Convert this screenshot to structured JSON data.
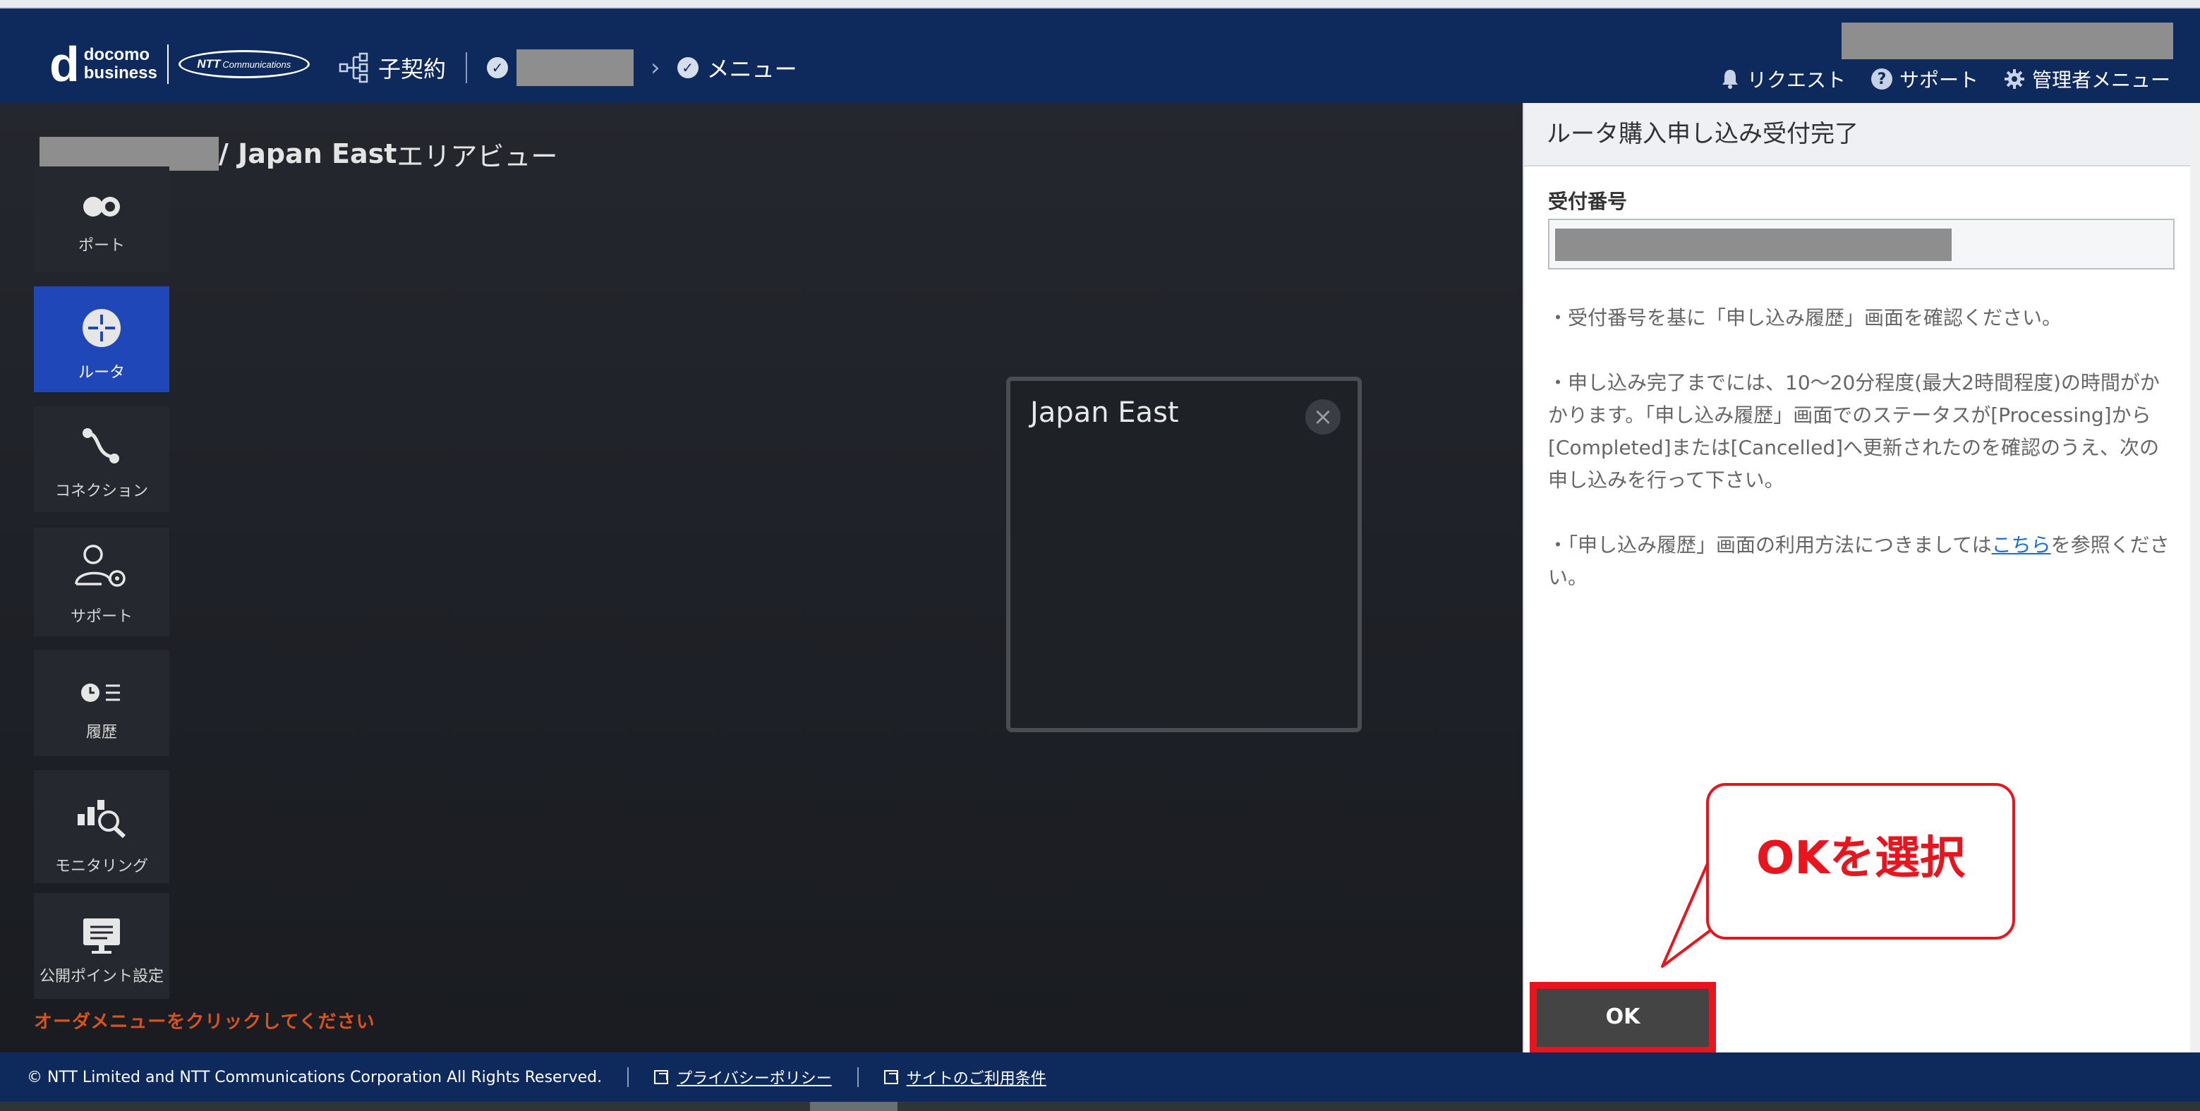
{
  "header": {
    "brand": {
      "glyph": "d",
      "line1": "docomo",
      "line2": "business",
      "ntt_logo": "NTT Communications",
      "ntt_bold": "NTT",
      "ntt_rest": "Communications"
    },
    "nav": {
      "contract_label": "子契約",
      "menu_label": "メニュー"
    },
    "links": {
      "request": "リクエスト",
      "support": "サポート",
      "admin_menu": "管理者メニュー"
    }
  },
  "main": {
    "title_suffix": "/ Japan East",
    "title_view": " エリアビュー",
    "sidebar": [
      {
        "label": "ポート",
        "icon": "port-icon",
        "active": false
      },
      {
        "label": "ルータ",
        "icon": "router-icon",
        "active": true
      },
      {
        "label": "コネクション",
        "icon": "connection-icon",
        "active": false
      },
      {
        "label": "サポート",
        "icon": "support-user-gear-icon",
        "active": false
      },
      {
        "label": "履歴",
        "icon": "history-clock-list-icon",
        "active": false
      },
      {
        "label": "モニタリング",
        "icon": "monitoring-chart-magnifier-icon",
        "active": false
      },
      {
        "label": "公開ポイント設定",
        "icon": "public-point-monitor-icon",
        "active": false
      }
    ],
    "order_hint": "オーダメニューをクリックしてください",
    "region_card": {
      "title": "Japan East",
      "close": "×"
    }
  },
  "panel": {
    "title": "ルータ購入申し込み受付完了",
    "field_label": "受付番号",
    "note1": "・受付番号を基に「申し込み履歴」画面を確認ください。",
    "note2": "・申し込み完了までには、10〜20分程度(最大2時間程度)の時間がかかります。「申し込み履歴」画面でのステータスが[Processing]から[Completed]または[Cancelled]へ更新されたのを確認のうえ、次の申し込みを行って下さい。",
    "note3_prefix": "・「申し込み履歴」画面の利用方法につきましては",
    "note3_link": "こちら",
    "note3_suffix": "を参照ください。",
    "ok_label": "OK"
  },
  "callout": {
    "text": "OKを選択"
  },
  "footer": {
    "copyright": "© NTT Limited and NTT Communications Corporation All Rights Reserved.",
    "privacy": "プライバシーポリシー",
    "terms": "サイトのご利用条件"
  },
  "colors": {
    "header_bg": "#0e2a5c",
    "active_item": "#2047b8",
    "callout_red": "#e8141e",
    "hint_orange": "#d8541c",
    "link_blue": "#1a6ed8"
  }
}
